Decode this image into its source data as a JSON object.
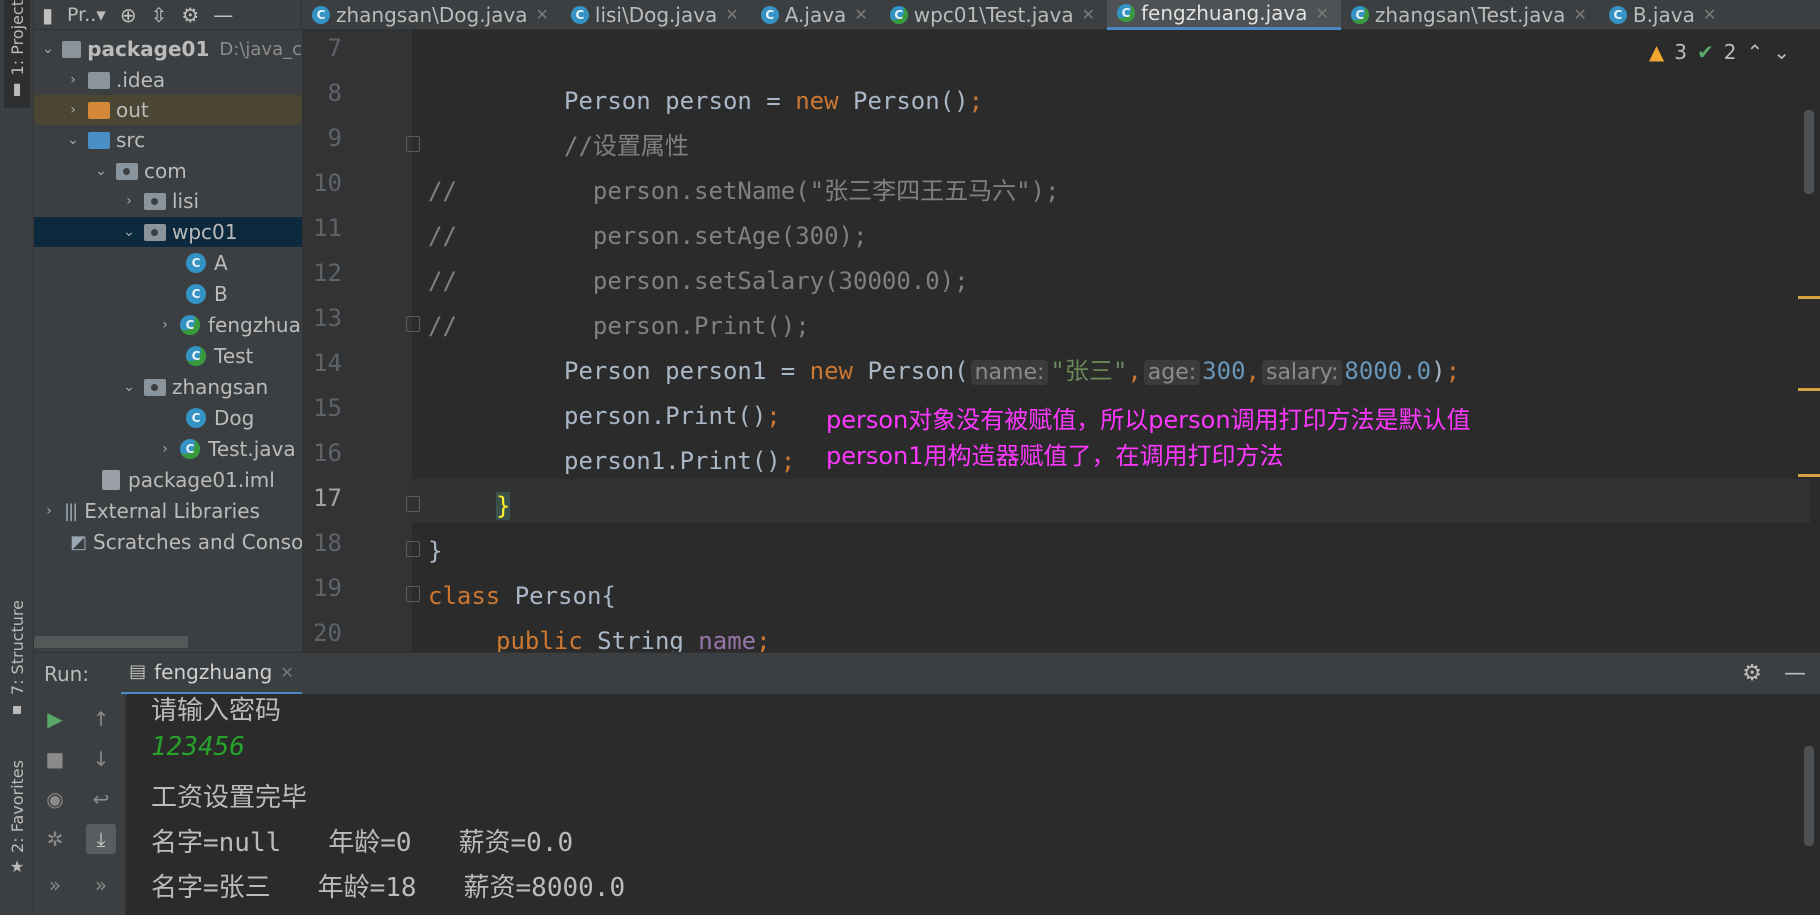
{
  "left_strip": {
    "project_tab": "1: Project",
    "structure_tab": "7: Structure",
    "favorites_tab": "2: Favorites"
  },
  "project_toolbar": {
    "title": "Pr..▾"
  },
  "editor_tabs": [
    {
      "label": "zhangsan\\Dog.java"
    },
    {
      "label": "lisi\\Dog.java"
    },
    {
      "label": "A.java"
    },
    {
      "label": "wpc01\\Test.java"
    },
    {
      "label": "fengzhuang.java",
      "active": true
    },
    {
      "label": "zhangsan\\Test.java"
    },
    {
      "label": "B.java"
    }
  ],
  "tree": {
    "root": "package01",
    "root_path": "D:\\java_c",
    "idea": ".idea",
    "out": "out",
    "src": "src",
    "com": "com",
    "lisi": "lisi",
    "wpc01": "wpc01",
    "a": "A",
    "b": "B",
    "fengzhuang": "fengzhua",
    "test": "Test",
    "zhangsan": "zhangsan",
    "dog": "Dog",
    "testjava": "Test.java",
    "iml": "package01.iml",
    "ext": "External Libraries",
    "scratch": "Scratches and Consol"
  },
  "inspections": {
    "warnings": "3",
    "ok": "2"
  },
  "gutter": {
    "lines": [
      "7",
      "8",
      "9",
      "10",
      "11",
      "12",
      "13",
      "14",
      "15",
      "16",
      "17",
      "18",
      "19",
      "20"
    ]
  },
  "code": {
    "l8_a": "Person person = ",
    "l8_new": "new",
    "l8_b": " Person()",
    "l8_semi": ";",
    "l9": "//设置属性",
    "l10_c": "//",
    "l10_a": "person.setName(\"张三李四王五马六\");",
    "l11_c": "//",
    "l11_a": "person.setAge(300);",
    "l12_c": "//",
    "l12_a": "person.setSalary(30000.0);",
    "l13_c": "//",
    "l13_a": "person.Print();",
    "l14_a": "Person person1 = ",
    "l14_new": "new",
    "l14_b": " Person(",
    "l14_h1": "name:",
    "l14_s1": "\"张三\"",
    "l14_comma1": ",",
    "l14_h2": "age:",
    "l14_n2": "300",
    "l14_comma2": ",",
    "l14_h3": "salary:",
    "l14_n3": "8000.0",
    "l14_end": ")",
    "l14_semi": ";",
    "l15_a": "person.Print()",
    "l15_semi": ";",
    "l16_a": "person1.Print()",
    "l16_semi": ";",
    "l17": "}",
    "l18": "}",
    "l19_kw": "class",
    "l19_a": " Person{",
    "l20_kw": "public",
    "l20_a": " String ",
    "l20_f": "name",
    "l20_semi": ";"
  },
  "annotations": {
    "note1": "person对象没有被赋值，所以person调用打印方法是默认值",
    "note2": "person1用构造器赋值了，在调用打印方法"
  },
  "run": {
    "label": "Run:",
    "tab": "fengzhuang"
  },
  "console": {
    "lines": [
      "请输入密码",
      "123456",
      "工资设置完毕",
      "名字=null   年龄=0   薪资=0.0",
      "名字=张三   年龄=18   薪资=8000.0"
    ]
  },
  "colors": {
    "keyword": "#cc7832",
    "string": "#6a8759",
    "number": "#6897bb",
    "comment": "#808080",
    "field": "#9876aa",
    "annotation": "#ff38ff",
    "console_input": "#27a32b",
    "accent": "#4a88c7"
  }
}
